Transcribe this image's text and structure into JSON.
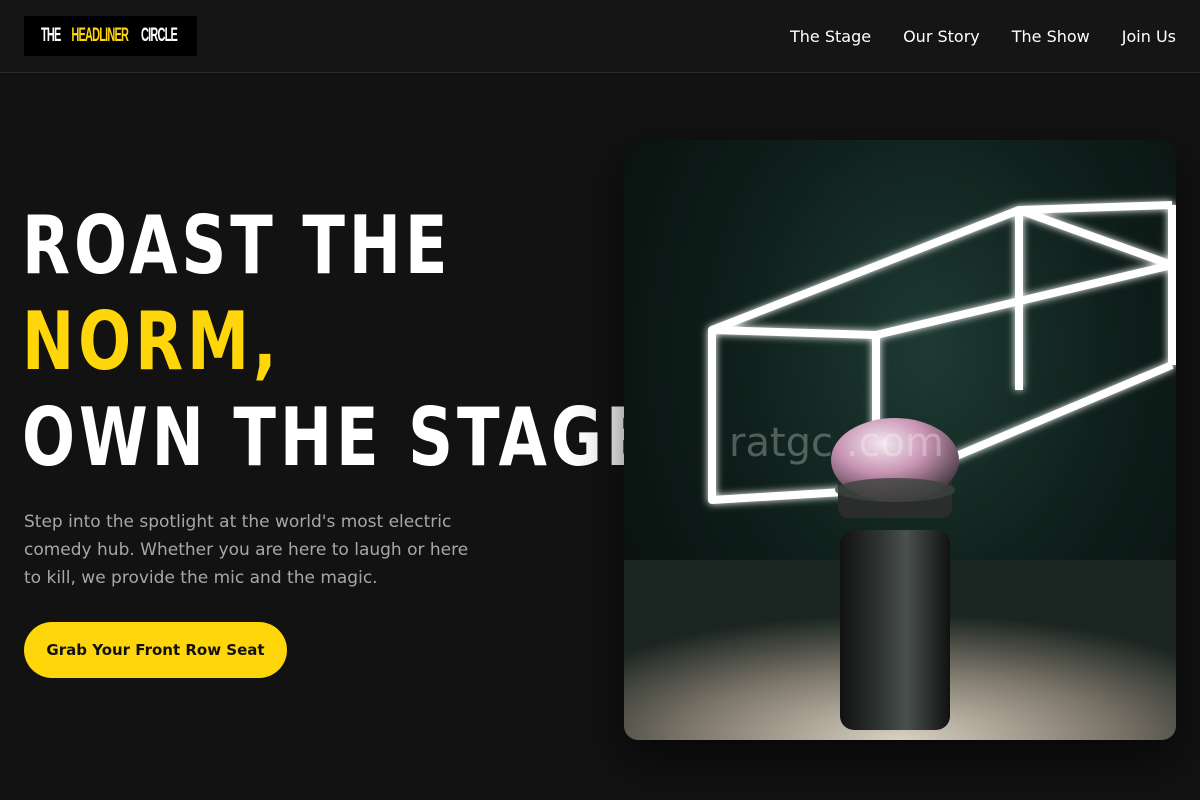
{
  "brand": {
    "part1": "THE",
    "part2": "HEADLINER",
    "part3": "CIRCLE",
    "accent_color": "#ffd60a"
  },
  "nav": {
    "items": [
      {
        "label": "The Stage"
      },
      {
        "label": "Our Story"
      },
      {
        "label": "The Show"
      },
      {
        "label": "Join Us"
      }
    ]
  },
  "hero": {
    "headline_line1": "ROAST THE",
    "headline_line2": "NORM,",
    "headline_line3": "OWN THE STAGE.",
    "lede": "Step into the spotlight at the world's most electric comedy hub. Whether you are here to laugh or here to kill, we provide the mic and the magic.",
    "cta_label": "Grab Your Front Row Seat",
    "image_icon": "microphone-stage-photo",
    "watermark": "ratgc    .com"
  },
  "colors": {
    "background": "#121212",
    "accent": "#ffd60a",
    "text_muted": "#a7a7a7"
  }
}
